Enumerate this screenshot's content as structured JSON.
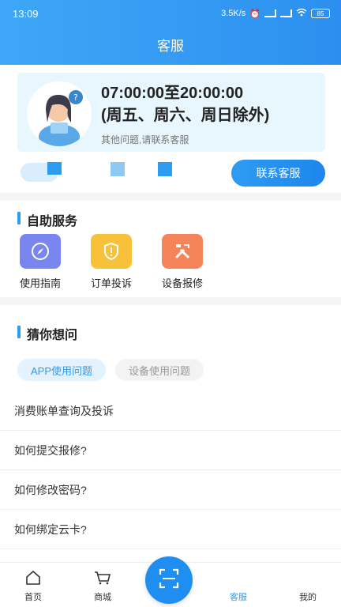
{
  "status_bar": {
    "time": "13:09",
    "net_speed": "3.5K/s",
    "battery": "85"
  },
  "header": {
    "title": "客服"
  },
  "hours": {
    "line1": "07:00:00至20:00:00",
    "line2": "(周五、周六、周日除外)",
    "note": "其他问题,请联系客服"
  },
  "contact_button": "联系客服",
  "self_service": {
    "title": "自助服务",
    "items": [
      {
        "label": "使用指南",
        "icon": "compass-icon",
        "color": "#7a86f0"
      },
      {
        "label": "订单投诉",
        "icon": "shield-alert-icon",
        "color": "#f7c23a"
      },
      {
        "label": "设备报修",
        "icon": "tools-icon",
        "color": "#f6845a"
      }
    ]
  },
  "guess": {
    "title": "猜你想问",
    "tabs": [
      {
        "label": "APP使用问题",
        "active": true
      },
      {
        "label": "设备使用问题",
        "active": false
      }
    ],
    "questions": [
      "消费账单查询及投诉",
      "如何提交报修?",
      "如何修改密码?",
      "如何绑定云卡?"
    ]
  },
  "tabbar": {
    "items": [
      {
        "label": "首页"
      },
      {
        "label": "商城"
      },
      {
        "label": "客服"
      },
      {
        "label": "我的"
      }
    ]
  },
  "colors": {
    "primary": "#2d9bf0",
    "header": "#3ea7f6"
  }
}
